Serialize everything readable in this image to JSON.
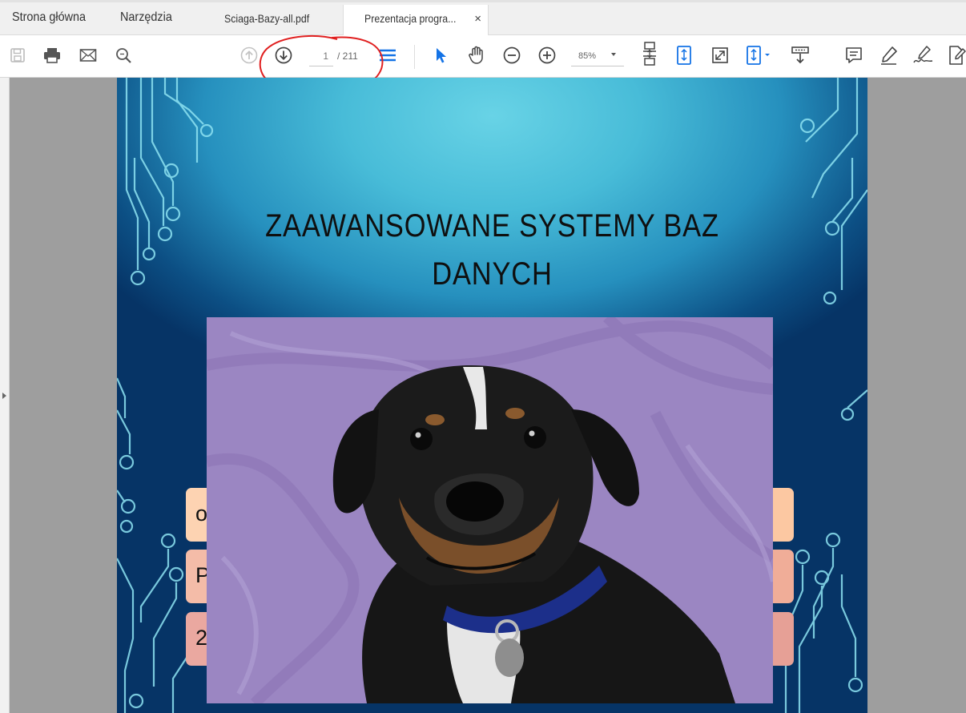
{
  "tabs": {
    "home": "Strona główna",
    "tools": "Narzędzia",
    "doc1": "Sciaga-Bazy-all.pdf",
    "doc2": "Prezentacja progra...",
    "close": "×"
  },
  "toolbar": {
    "page_current": "1",
    "page_total": "/ 211",
    "zoom": "85%",
    "icons": [
      "save-icon",
      "print-icon",
      "email-icon",
      "search-icon",
      "page-up-icon",
      "page-down-icon",
      "page-layout-icon",
      "select-cursor-icon",
      "hand-tool-icon",
      "zoom-out-icon",
      "zoom-in-icon",
      "fit-page-icon",
      "scroll-mode-icon",
      "fullscreen-icon",
      "export-icon",
      "read-mode-icon",
      "comment-icon",
      "highlight-icon",
      "sign-icon",
      "fill-sign-icon"
    ]
  },
  "slide": {
    "title_line1": "ZAAWANSOWANE SYSTEMY BAZ",
    "title_line2": "DANYCH",
    "pill1": "o",
    "pill2": "P",
    "pill3": "2"
  },
  "colors": {
    "accent": "#1473e6",
    "annotation": "#e02020",
    "slide_bg_light": "#68d3e6",
    "slide_bg_dark": "#063466",
    "photo_bg": "#9b86c2"
  }
}
